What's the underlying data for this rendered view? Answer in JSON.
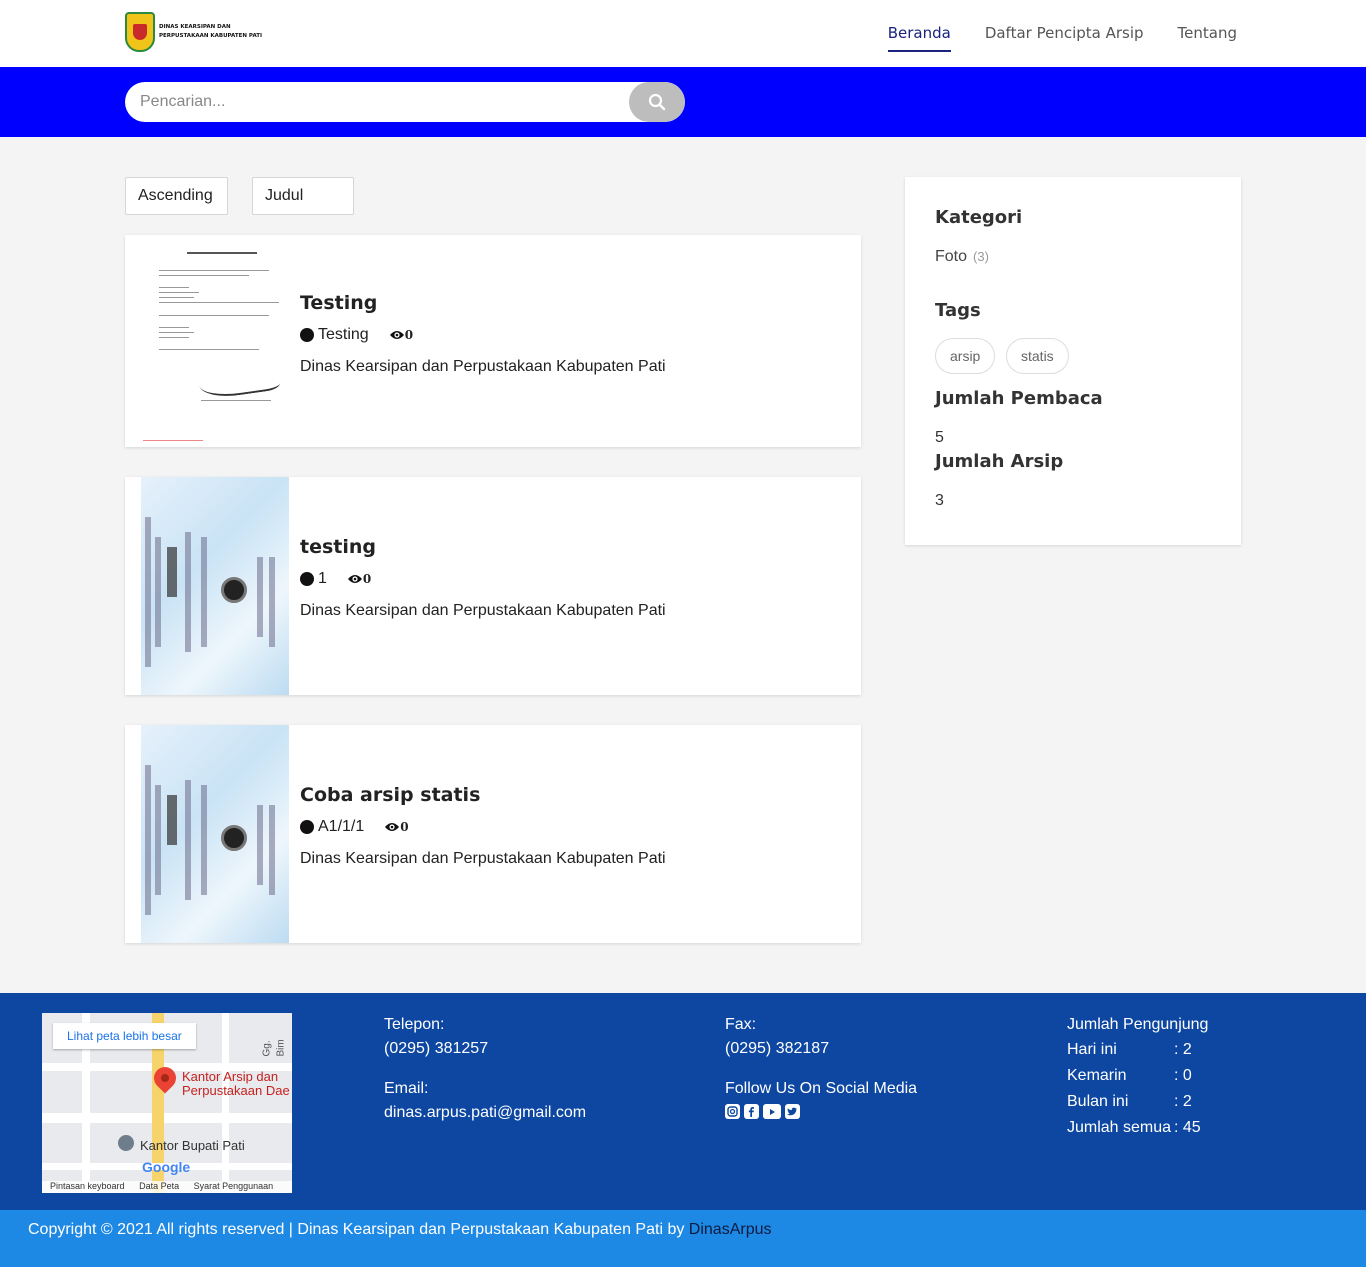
{
  "header": {
    "logo_text": "DINAS KEARSIPAN DAN PERPUSTAKAAN KABUPATEN PATI",
    "nav": [
      {
        "label": "Beranda",
        "active": true
      },
      {
        "label": "Daftar Pencipta Arsip",
        "active": false
      },
      {
        "label": "Tentang",
        "active": false
      }
    ]
  },
  "search": {
    "placeholder": "Pencarian...",
    "icon": "search-icon"
  },
  "sort": {
    "order": "Ascending",
    "field": "Judul"
  },
  "cards": [
    {
      "title": "Testing",
      "code": "Testing",
      "views": "0",
      "agency": "Dinas Kearsipan dan Perpustakaan Kabupaten Pati",
      "thumbnail": "document"
    },
    {
      "title": "testing",
      "code": "1",
      "views": "0",
      "agency": "Dinas Kearsipan dan Perpustakaan Kabupaten Pati",
      "thumbnail": "certificate"
    },
    {
      "title": "Coba arsip statis",
      "code": "A1/1/1",
      "views": "0",
      "agency": "Dinas Kearsipan dan Perpustakaan Kabupaten Pati",
      "thumbnail": "certificate"
    }
  ],
  "sidebar": {
    "category_heading": "Kategori",
    "categories": [
      {
        "name": "Foto",
        "count": "(3)"
      }
    ],
    "tags_heading": "Tags",
    "tags": [
      "arsip",
      "statis"
    ],
    "readers_heading": "Jumlah Pembaca",
    "readers_value": "5",
    "archives_heading": "Jumlah Arsip",
    "archives_value": "3"
  },
  "footer": {
    "map": {
      "link": "Lihat peta lebih besar",
      "place": "Kantor Arsip dan Perpustakaan Dae",
      "landmark": "Kantor Bupati Pati",
      "google": "Google",
      "street": "Gg. Bim",
      "attribution": [
        "Pintasan keyboard",
        "Data Peta",
        "Syarat Penggunaan"
      ]
    },
    "phone_label": "Telepon:",
    "phone": "(0295) 381257",
    "email_label": "Email:",
    "email": "dinas.arpus.pati@gmail.com",
    "fax_label": "Fax:",
    "fax": "(0295) 382187",
    "social_label": "Follow Us On Social Media",
    "social_icons": [
      "instagram-icon",
      "facebook-icon",
      "youtube-icon",
      "twitter-icon"
    ],
    "visitors_heading": "Jumlah Pengunjung",
    "visitors": [
      {
        "label": "Hari ini",
        "value": ": 2"
      },
      {
        "label": "Kemarin",
        "value": ": 0"
      },
      {
        "label": "Bulan ini",
        "value": ": 2"
      },
      {
        "label": "Jumlah semua",
        "value": ": 45"
      }
    ]
  },
  "copyright": {
    "text": "Copyright © 2021 All rights reserved | Dinas Kearsipan dan Perpustakaan Kabupaten Pati by ",
    "link": "DinasArpus"
  },
  "colors": {
    "nav_blue": "#0000ff",
    "footer": "#0d47a1",
    "copyright_bar": "#1e88e5"
  }
}
